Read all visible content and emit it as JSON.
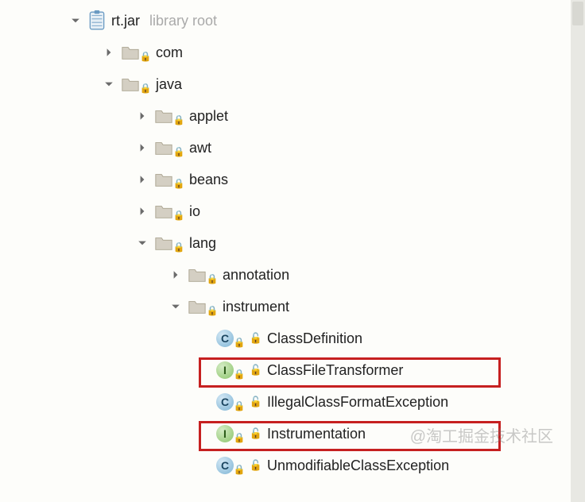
{
  "root": {
    "name": "rt.jar",
    "suffix": "library root"
  },
  "packages": {
    "com": "com",
    "java": "java",
    "applet": "applet",
    "awt": "awt",
    "beans": "beans",
    "io": "io",
    "lang": "lang",
    "annotation": "annotation",
    "instrument": "instrument"
  },
  "classes": {
    "classDefinition": "ClassDefinition",
    "classFileTransformer": "ClassFileTransformer",
    "illegalClassFormatException": "IllegalClassFormatException",
    "instrumentation": "Instrumentation",
    "unmodifiableClassException": "UnmodifiableClassException"
  },
  "watermark": "@淘工掘金技术社区"
}
